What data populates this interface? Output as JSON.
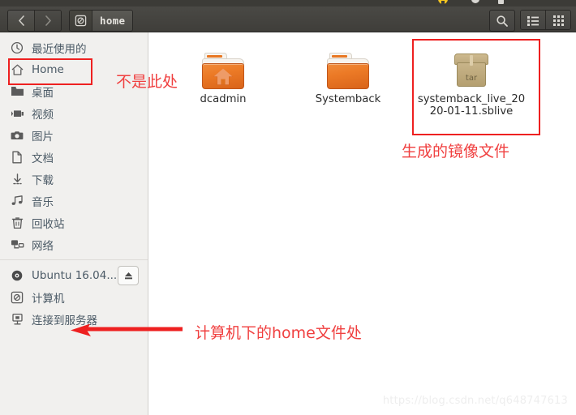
{
  "window": {
    "title": "home",
    "path_icon": "drive-harddisk-icon"
  },
  "toolbar": {
    "back_label": "‹",
    "forward_label": "›",
    "search_label": "search-icon",
    "list_view_label": "list-view-icon",
    "grid_view_label": "grid-view-icon"
  },
  "sidebar": {
    "items": [
      {
        "icon": "recent-clock-icon",
        "label": "最近使用的"
      },
      {
        "icon": "home-icon",
        "label": "Home"
      },
      {
        "icon": "desktop-folder-icon",
        "label": "桌面"
      },
      {
        "icon": "videos-icon",
        "label": "视频"
      },
      {
        "icon": "pictures-camera-icon",
        "label": "图片"
      },
      {
        "icon": "documents-page-icon",
        "label": "文档"
      },
      {
        "icon": "downloads-arrow-icon",
        "label": "下载"
      },
      {
        "icon": "music-note-icon",
        "label": "音乐"
      },
      {
        "icon": "trash-icon",
        "label": "回收站"
      },
      {
        "icon": "network-icon",
        "label": "网络"
      }
    ],
    "devices": [
      {
        "icon": "optical-disc-icon",
        "label": "Ubuntu 16.04....",
        "eject": true,
        "eject_label": "eject-icon"
      },
      {
        "icon": "computer-drive-icon",
        "label": "计算机",
        "eject": false
      },
      {
        "icon": "connect-server-icon",
        "label": "连接到服务器",
        "eject": false
      }
    ]
  },
  "files": [
    {
      "icon": "home-folder-icon",
      "name": "dcadmin"
    },
    {
      "icon": "folder-icon",
      "name": "Systemback"
    },
    {
      "icon": "tar-archive-icon",
      "name": "systemback_live_2020-01-11.sblive",
      "tar_badge": "tar",
      "selected": true
    }
  ],
  "annotations": {
    "not_here": "不是此处",
    "generated_image_file": "生成的镜像文件",
    "home_under_computer": "计算机下的home文件处",
    "box_home_label": "highlight-box-home",
    "box_file_label": "highlight-box-sblive",
    "arrow_label": "pointer-arrow-to-computer",
    "color": "#ee2020"
  },
  "watermark": {
    "text": "https://blog.csdn.net/q648747613"
  },
  "colors": {
    "accent_orange": "#e87722",
    "annotation_red": "#ee2020",
    "sidebar_bg": "#f1f0ee",
    "header_bg": "#43423e"
  }
}
